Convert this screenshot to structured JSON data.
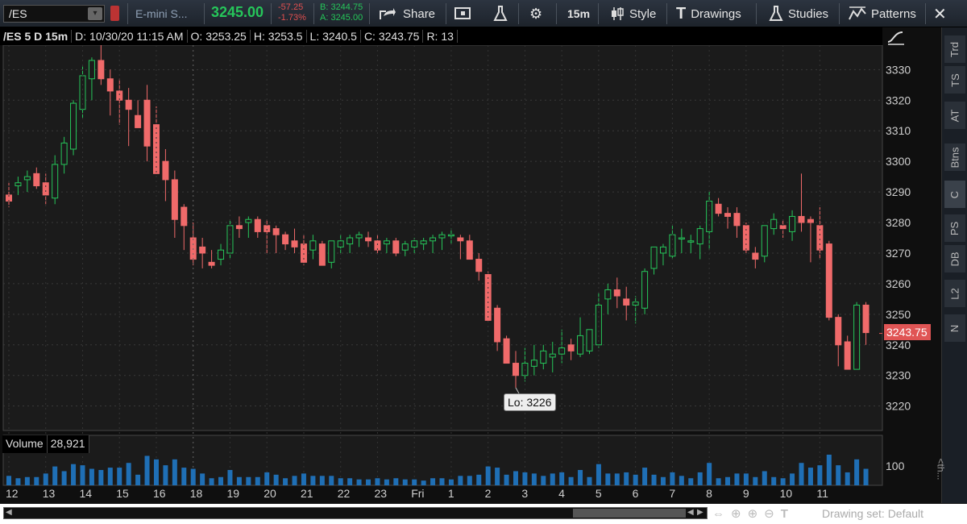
{
  "toolbar": {
    "symbol": "/ES",
    "description": "E-mini S...",
    "last_price": "3245.00",
    "net_change": "-57.25",
    "pct_change": "-1.73%",
    "bid": "B: 3244.75",
    "ask": "A: 3245.00",
    "share_label": "Share",
    "timeframe": "15m",
    "style_label": "Style",
    "drawings_label": "Drawings",
    "studies_label": "Studies",
    "patterns_label": "Patterns"
  },
  "info_bar": {
    "symbol_period": "/ES 5 D 15m",
    "date": "D: 10/30/20 11:15 AM",
    "open": "O: 3253.25",
    "high": "H: 3253.5",
    "low": "L: 3240.5",
    "close": "C: 3243.75",
    "range": "R: 13"
  },
  "right_tabs": [
    "Trd",
    "TS",
    "AT",
    "Btns",
    "C",
    "PS",
    "DB",
    "L2",
    "N"
  ],
  "price_tag": "3243.75",
  "low_tag": "Lo: 3226",
  "volume": {
    "label": "Volume",
    "value": "28,921",
    "axis_label": "100"
  },
  "side_collapse": "<th...",
  "bottom": {
    "drawing_set": "Drawing set: Default"
  },
  "colors": {
    "up": "#26c65a",
    "down": "#f06a6a",
    "volume": "#1f6fb5",
    "background": "#1b1b1b"
  },
  "chart_data": {
    "type": "candlestick",
    "y_ticks": [
      3220,
      3230,
      3240,
      3250,
      3260,
      3270,
      3280,
      3290,
      3300,
      3310,
      3320,
      3330
    ],
    "ylim": [
      3212,
      3338
    ],
    "x_labels": [
      "12",
      "13",
      "14",
      "15",
      "16",
      "18",
      "19",
      "20",
      "21",
      "22",
      "23",
      "Fri",
      "1",
      "2",
      "3",
      "4",
      "5",
      "6",
      "7",
      "8",
      "9",
      "10",
      "11"
    ],
    "candles": [
      [
        3289,
        3293,
        3285,
        3287
      ],
      [
        3292,
        3295,
        3289,
        3293
      ],
      [
        3294,
        3297,
        3290,
        3295
      ],
      [
        3296,
        3298,
        3291,
        3292
      ],
      [
        3293,
        3296,
        3286,
        3289
      ],
      [
        3288,
        3302,
        3286,
        3299
      ],
      [
        3299,
        3308,
        3296,
        3306
      ],
      [
        3304,
        3320,
        3302,
        3319
      ],
      [
        3317,
        3331,
        3314,
        3328
      ],
      [
        3327,
        3334,
        3320,
        3333
      ],
      [
        3333,
        3338,
        3325,
        3327
      ],
      [
        3327,
        3330,
        3315,
        3323
      ],
      [
        3323,
        3327,
        3312,
        3320
      ],
      [
        3320,
        3324,
        3305,
        3317
      ],
      [
        3315,
        3320,
        3311,
        3311
      ],
      [
        3320,
        3325,
        3300,
        3305
      ],
      [
        3312,
        3318,
        3296,
        3296
      ],
      [
        3300,
        3304,
        3287,
        3294
      ],
      [
        3294,
        3297,
        3275,
        3281
      ],
      [
        3285,
        3286,
        3271,
        3279
      ],
      [
        3275,
        3280,
        3266,
        3268
      ],
      [
        3272,
        3275,
        3265,
        3270
      ],
      [
        3267,
        3271,
        3265,
        3266
      ],
      [
        3268,
        3273,
        3266,
        3271
      ],
      [
        3270,
        3281,
        3268,
        3279
      ],
      [
        3279,
        3282,
        3275,
        3278
      ],
      [
        3280,
        3282,
        3275,
        3281
      ],
      [
        3281,
        3282,
        3275,
        3277
      ],
      [
        3279,
        3281,
        3270,
        3277
      ],
      [
        3278,
        3279,
        3270,
        3276
      ],
      [
        3276,
        3277,
        3271,
        3273
      ],
      [
        3274,
        3278,
        3270,
        3272
      ],
      [
        3273,
        3276,
        3266,
        3267
      ],
      [
        3271,
        3276,
        3268,
        3274
      ],
      [
        3273,
        3274,
        3266,
        3266
      ],
      [
        3267,
        3273,
        3265,
        3274
      ],
      [
        3272,
        3276,
        3270,
        3274
      ],
      [
        3273,
        3276,
        3270,
        3275
      ],
      [
        3275,
        3277,
        3272,
        3276
      ],
      [
        3275,
        3277,
        3272,
        3274
      ],
      [
        3274,
        3276,
        3270,
        3271
      ],
      [
        3273,
        3275,
        3270,
        3274
      ],
      [
        3274,
        3275,
        3269,
        3270
      ],
      [
        3271,
        3274,
        3269,
        3273
      ],
      [
        3272,
        3275,
        3270,
        3274
      ],
      [
        3273,
        3275,
        3271,
        3274
      ],
      [
        3274,
        3276,
        3270,
        3275
      ],
      [
        3275,
        3277,
        3271,
        3276
      ],
      [
        3276,
        3278,
        3273,
        3276
      ],
      [
        3275,
        3276,
        3268,
        3274
      ],
      [
        3274,
        3276,
        3268,
        3268
      ],
      [
        3268,
        3270,
        3261,
        3264
      ],
      [
        3263,
        3264,
        3248,
        3248
      ],
      [
        3252,
        3253,
        3238,
        3241
      ],
      [
        3242,
        3243,
        3234,
        3234
      ],
      [
        3234,
        3238,
        3226,
        3230
      ],
      [
        3230,
        3239,
        3228,
        3234
      ],
      [
        3233,
        3240,
        3230,
        3235
      ],
      [
        3234,
        3240,
        3232,
        3238
      ],
      [
        3236,
        3241,
        3231,
        3237
      ],
      [
        3237,
        3245,
        3234,
        3239
      ],
      [
        3240,
        3242,
        3235,
        3238
      ],
      [
        3237,
        3249,
        3236,
        3243
      ],
      [
        3238,
        3244,
        3237,
        3245
      ],
      [
        3240,
        3257,
        3239,
        3253
      ],
      [
        3255,
        3260,
        3250,
        3258
      ],
      [
        3258,
        3262,
        3252,
        3256
      ],
      [
        3255,
        3259,
        3248,
        3253
      ],
      [
        3253,
        3256,
        3247,
        3254
      ],
      [
        3252,
        3265,
        3250,
        3264
      ],
      [
        3265,
        3272,
        3263,
        3272
      ],
      [
        3270,
        3273,
        3266,
        3272
      ],
      [
        3269,
        3279,
        3268,
        3276
      ],
      [
        3275,
        3278,
        3270,
        3275
      ],
      [
        3274,
        3276,
        3270,
        3274
      ],
      [
        3273,
        3279,
        3268,
        3278
      ],
      [
        3277,
        3290,
        3271,
        3287
      ],
      [
        3286,
        3288,
        3282,
        3283
      ],
      [
        3283,
        3285,
        3278,
        3282
      ],
      [
        3283,
        3285,
        3275,
        3279
      ],
      [
        3279,
        3280,
        3270,
        3271
      ],
      [
        3270,
        3272,
        3265,
        3268
      ],
      [
        3269,
        3279,
        3267,
        3279
      ],
      [
        3278,
        3283,
        3276,
        3281
      ],
      [
        3279,
        3281,
        3275,
        3278
      ],
      [
        3277,
        3284,
        3274,
        3282
      ],
      [
        3282,
        3296,
        3277,
        3280
      ],
      [
        3281,
        3282,
        3267,
        3280
      ],
      [
        3279,
        3285,
        3268,
        3271
      ],
      [
        3273,
        3274,
        3248,
        3249
      ],
      [
        3249,
        3250,
        3233,
        3240
      ],
      [
        3241,
        3243,
        3232,
        3232
      ],
      [
        3232,
        3254,
        3232,
        3253
      ],
      [
        3253,
        3254,
        3240,
        3244
      ]
    ],
    "volume_levels": "relative bar heights shown in volume pane"
  }
}
